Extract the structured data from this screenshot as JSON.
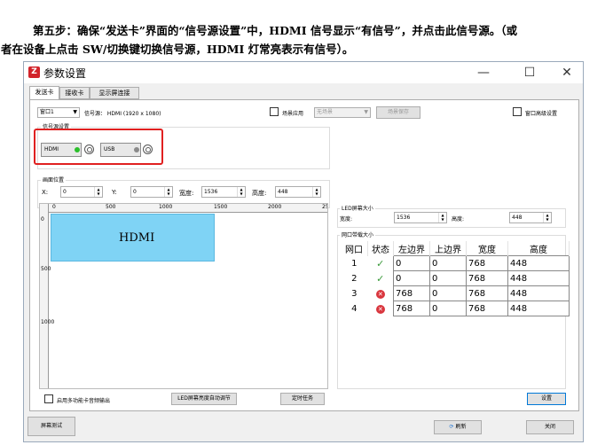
{
  "doc": {
    "line1": "第五步：确保“发送卡”界面的“信号源设置”中，HDMI 信号显示“有信号”，并点击此信号源。（或",
    "line2": "者在设备上点击 SW/切换键切换信号源，HDMI 灯常亮表示有信号）。"
  },
  "window": {
    "title": "参数设置",
    "logo": "Z",
    "controls": {
      "minimize": "—",
      "maximize": "☐",
      "close": "✕"
    }
  },
  "tabs": [
    {
      "label": "发送卡",
      "active": true
    },
    {
      "label": "接收卡",
      "active": false
    },
    {
      "label": "显示屏连接",
      "active": false
    }
  ],
  "toolbar": {
    "window_select": "窗口1",
    "signal_source": "信号源： HDMI (1920 x 1080)",
    "scene_apply": "场景应用",
    "scene_select": "无场景",
    "scene_save": "场景保存",
    "window_advanced": "窗口高级设置"
  },
  "source_settings": {
    "title": "信号源设置",
    "sources": [
      {
        "label": "HDMI",
        "status_color": "#2bbf2b"
      },
      {
        "label": "USB",
        "status_color": "#8a8a8a"
      }
    ]
  },
  "picture_position": {
    "title": "画面位置",
    "x_label": "X:",
    "x": "0",
    "y_label": "Y:",
    "y": "0",
    "width_label": "宽度:",
    "width": "1536",
    "height_label": "高度:",
    "height": "448"
  },
  "canvas": {
    "ruler_top": [
      "0",
      "500",
      "1000",
      "1500",
      "2000",
      "25"
    ],
    "ruler_left": [
      "0",
      "500",
      "1000"
    ],
    "hdmi_label": "HDMI",
    "hdmi_color": "#7fd3f5"
  },
  "led_size": {
    "title": "LED屏幕大小",
    "width_label": "宽度:",
    "width": "1536",
    "height_label": "高度:",
    "height": "448"
  },
  "network": {
    "title": "网口带载大小",
    "headers": [
      "网口",
      "状态",
      "左边界",
      "上边界",
      "宽度",
      "高度"
    ],
    "rows": [
      {
        "port": "1",
        "status": "ok",
        "left": "0",
        "top": "0",
        "width": "768",
        "height": "448"
      },
      {
        "port": "2",
        "status": "ok",
        "left": "0",
        "top": "0",
        "width": "768",
        "height": "448"
      },
      {
        "port": "3",
        "status": "error",
        "left": "768",
        "top": "0",
        "width": "768",
        "height": "448"
      },
      {
        "port": "4",
        "status": "error",
        "left": "768",
        "top": "0",
        "width": "768",
        "height": "448"
      }
    ]
  },
  "bottom": {
    "multi_audio": "启用多功能卡音频输出",
    "led_brightness": "LED屏幕亮度自动调节",
    "timer": "定时任务",
    "settings": "设置"
  },
  "footer": {
    "screen_test": "屏幕测试",
    "refresh": "刷新",
    "close": "关闭"
  },
  "icons": {
    "checkbox_checked": "✓",
    "error": "✕"
  }
}
